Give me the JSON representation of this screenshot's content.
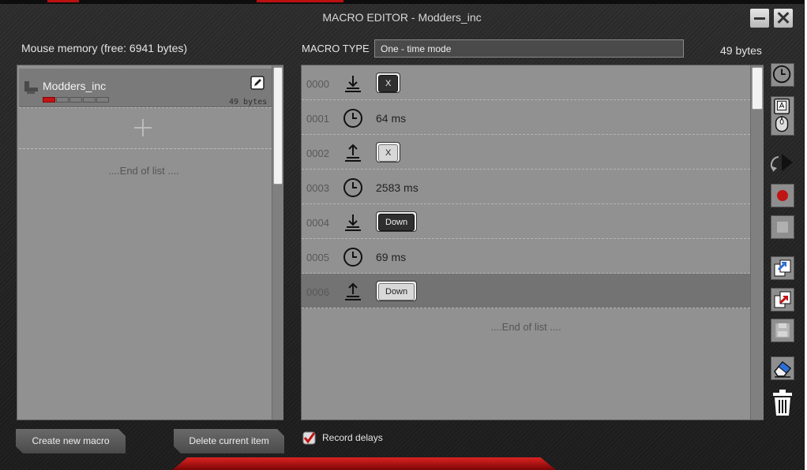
{
  "window": {
    "title": "MACRO EDITOR - Modders_inc",
    "minimize_icon": "minimize-icon",
    "close_icon": "close-icon"
  },
  "memory": {
    "label": "Mouse memory (free: 6941 bytes)"
  },
  "macro_list": {
    "items": [
      {
        "name": "Modders_inc",
        "bytes": "49 bytes",
        "usage_segments_filled": 1,
        "usage_segments_total": 5,
        "icon": "macro-icon",
        "edit_icon": "edit-icon"
      }
    ],
    "add_icon": "plus-icon",
    "end_text": "....End of list ...."
  },
  "macro_type": {
    "label": "MACRO TYPE",
    "value": "One - time mode"
  },
  "size_label": "49 bytes",
  "steps": [
    {
      "index": "0000",
      "type": "key-down",
      "icon": "key-press-icon",
      "key": "X",
      "style": "dark"
    },
    {
      "index": "0001",
      "type": "delay",
      "icon": "clock-icon",
      "text": "64 ms"
    },
    {
      "index": "0002",
      "type": "key-up",
      "icon": "key-release-icon",
      "key": "X",
      "style": "light"
    },
    {
      "index": "0003",
      "type": "delay",
      "icon": "clock-icon",
      "text": "2583 ms"
    },
    {
      "index": "0004",
      "type": "key-down",
      "icon": "key-press-icon",
      "key": "Down",
      "style": "dark"
    },
    {
      "index": "0005",
      "type": "delay",
      "icon": "clock-icon",
      "text": "69 ms"
    },
    {
      "index": "0006",
      "type": "key-up",
      "icon": "key-release-icon",
      "key": "Down",
      "style": "light",
      "selected": true
    }
  ],
  "steps_end_text": "....End of list ....",
  "tools": [
    {
      "name": "add-delay-icon"
    },
    {
      "name": "insert-key-mouse-icon"
    },
    {
      "name": "cursor-move-icon"
    },
    {
      "name": "record-icon",
      "color": "#c01515"
    },
    {
      "name": "stop-icon"
    },
    {
      "name": "copy-icon"
    },
    {
      "name": "paste-icon"
    },
    {
      "name": "save-icon"
    },
    {
      "name": "eraser-icon"
    },
    {
      "name": "trash-icon"
    }
  ],
  "buttons": {
    "create": "Create new macro",
    "delete": "Delete current item"
  },
  "record_delays": {
    "label": "Record delays",
    "checked": true
  },
  "colors": {
    "accent": "#c01515",
    "panel": "#919191",
    "selected_row": "#737373"
  }
}
